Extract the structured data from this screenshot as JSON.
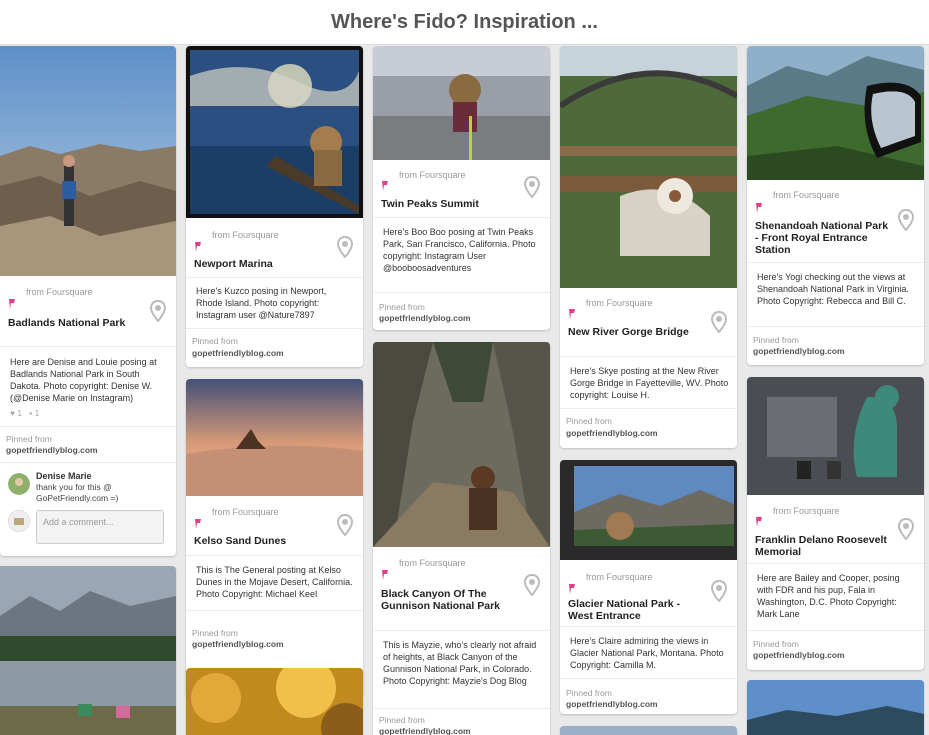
{
  "board": {
    "title": "Where's Fido? Inspiration ..."
  },
  "common": {
    "from": "from Foursquare",
    "pinned_from": "Pinned from",
    "site": "gopetfriendlyblog.com"
  },
  "pins": [
    {
      "id": "badlands",
      "title": "Badlands National Park",
      "desc": "Here are Denise and Louie posing at Badlands National Park in South Dakota. Photo copyright: Denise W. (@Denise Marie on Instagram)",
      "likes": "1",
      "comments_count": "1",
      "comment": {
        "name": "Denise Marie",
        "text": "thank you for this @ GoPetFriendly.com =)"
      },
      "add_comment_placeholder": "Add a comment..."
    },
    {
      "id": "newport",
      "title": "Newport Marina",
      "desc": "Here's Kuzco posing in Newport, Rhode Island. Photo copyright: Instagram user @Nature7897"
    },
    {
      "id": "kelso",
      "title": "Kelso Sand Dunes",
      "desc": "This is The General posting at Kelso Dunes in the Mojave Desert, California. Photo Copyright: Michael Keel"
    },
    {
      "id": "twinpeaks",
      "title": "Twin Peaks Summit",
      "desc": "Here's Boo Boo posing at Twin Peaks Park, San Francisco, California. Photo copyright: Instagram User @booboosadventures"
    },
    {
      "id": "blackcanyon",
      "title": "Black Canyon Of The Gunnison National Park",
      "desc": "This is Mayzie, who's clearly not afraid of heights, at Black Canyon of the Gunnison National Park, in Colorado. Photo Copyright: Mayzie's Dog Blog"
    },
    {
      "id": "newriver",
      "title": "New River Gorge Bridge",
      "desc": "Here's Skye posting at the New River Gorge Bridge in Fayetteville, WV. Photo copyright: Louise H."
    },
    {
      "id": "glacier",
      "title": "Glacier National Park - West Entrance",
      "desc": "Here's Claire admiring the views in Glacier National Park, Montana. Photo Copyright: Camilla M."
    },
    {
      "id": "shenandoah",
      "title": "Shenandoah National Park - Front Royal Entrance Station",
      "desc": "Here's Yogi checking out the views at Shenandoah National Park in Virginia. Photo Copyright: Rebecca and Bill C."
    },
    {
      "id": "fdr",
      "title": "Franklin Delano Roosevelt Memorial",
      "desc": "Here are Bailey and Cooper, posing with FDR and his pup, Fala in Washington, D.C. Photo Copyright: Mark Lane"
    }
  ]
}
